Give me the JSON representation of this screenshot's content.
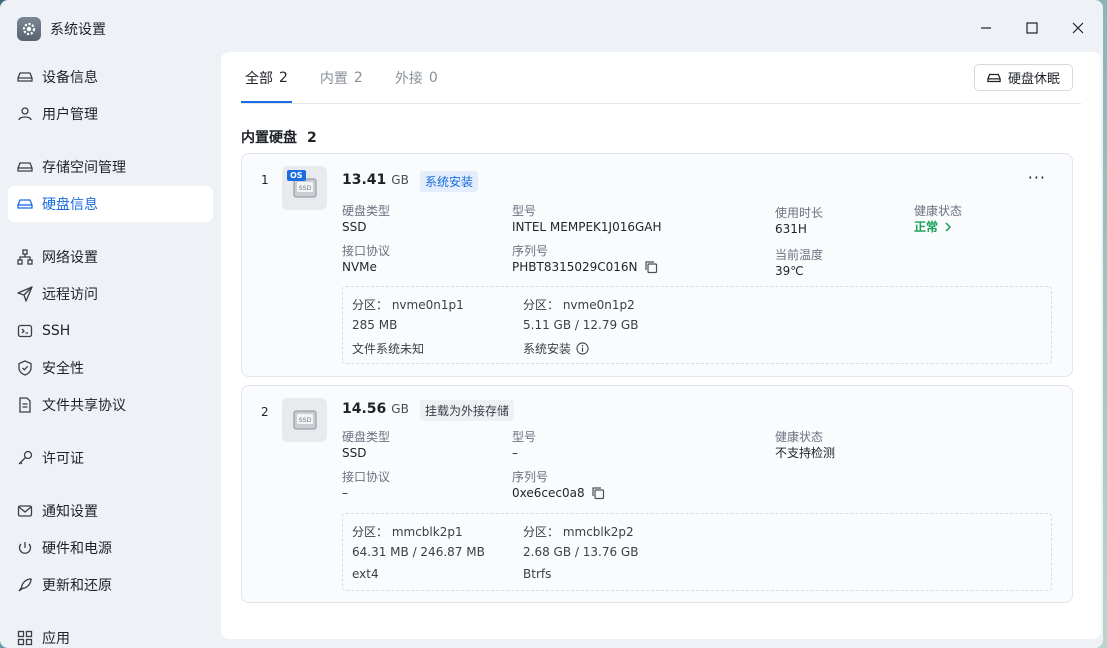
{
  "window": {
    "title": "系统设置"
  },
  "sidebar": {
    "items": [
      {
        "label": "设备信息",
        "icon": "drive-icon"
      },
      {
        "label": "用户管理",
        "icon": "user-icon"
      },
      {
        "label": "存储空间管理",
        "icon": "drive-icon"
      },
      {
        "label": "硬盘信息",
        "icon": "drive-icon",
        "active": true
      },
      {
        "label": "网络设置",
        "icon": "network-icon"
      },
      {
        "label": "远程访问",
        "icon": "send-icon"
      },
      {
        "label": "SSH",
        "icon": "terminal-icon"
      },
      {
        "label": "安全性",
        "icon": "shield-icon"
      },
      {
        "label": "文件共享协议",
        "icon": "file-icon"
      },
      {
        "label": "许可证",
        "icon": "key-icon"
      },
      {
        "label": "通知设置",
        "icon": "mail-icon"
      },
      {
        "label": "硬件和电源",
        "icon": "power-icon"
      },
      {
        "label": "更新和还原",
        "icon": "rocket-icon"
      },
      {
        "label": "应用",
        "icon": "apps-icon"
      }
    ]
  },
  "tabs": [
    {
      "label": "全部",
      "count": "2",
      "active": true
    },
    {
      "label": "内置",
      "count": "2"
    },
    {
      "label": "外接",
      "count": "0"
    }
  ],
  "sleep_button": "硬盘休眠",
  "section": {
    "title": "内置硬盘",
    "count": "2"
  },
  "disks": [
    {
      "index": "1",
      "badge": "OS",
      "size": "13.41",
      "unit": "GB",
      "tag": "系统安装",
      "more": "···",
      "type_label": "硬盘类型",
      "type": "SSD",
      "model_label": "型号",
      "model": "INTEL MEMPEK1J016GAH",
      "usage_label": "使用时长",
      "usage": "631H",
      "health_label": "健康状态",
      "health": "正常",
      "iface_label": "接口协议",
      "iface": "NVMe",
      "serial_label": "序列号",
      "serial": "PHBT8315029C016N",
      "temp_label": "当前温度",
      "temp": "39℃",
      "partitions": [
        {
          "name": "分区：  nvme0n1p1",
          "size": "285 MB",
          "fs": "文件系统未知"
        },
        {
          "name": "分区：  nvme0n1p2",
          "size": "5.11 GB / 12.79 GB",
          "fs": "系统安装"
        }
      ]
    },
    {
      "index": "2",
      "size": "14.56",
      "unit": "GB",
      "tag": "挂载为外接存储",
      "type_label": "硬盘类型",
      "type": "SSD",
      "model_label": "型号",
      "model": "–",
      "health_label": "健康状态",
      "health": "不支持检测",
      "iface_label": "接口协议",
      "iface": "–",
      "serial_label": "序列号",
      "serial": "0xe6cec0a8",
      "partitions": [
        {
          "name": "分区：  mmcblk2p1",
          "size": "64.31 MB / 246.87 MB",
          "fs": "ext4"
        },
        {
          "name": "分区：  mmcblk2p2",
          "size": "2.68 GB / 13.76 GB",
          "fs": "Btrfs"
        }
      ]
    }
  ]
}
